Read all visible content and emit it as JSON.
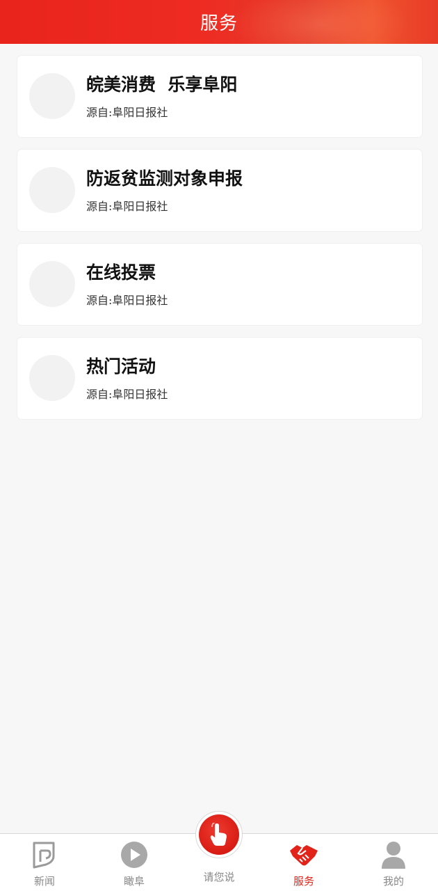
{
  "header": {
    "title": "服务"
  },
  "services": [
    {
      "title": "皖美消费  乐享阜阳",
      "source": "源自:阜阳日报社"
    },
    {
      "title": "防返贫监测对象申报",
      "source": "源自:阜阳日报社"
    },
    {
      "title": "在线投票",
      "source": "源自:阜阳日报社"
    },
    {
      "title": "热门活动",
      "source": "源自:阜阳日报社"
    }
  ],
  "tabbar": {
    "tabs": [
      {
        "label": "新闻",
        "icon": "news-icon"
      },
      {
        "label": "瞰阜",
        "icon": "play-icon"
      },
      {
        "label": "请您说",
        "icon": "tap-hand-icon"
      },
      {
        "label": "服务",
        "icon": "handshake-icon",
        "active": true
      },
      {
        "label": "我的",
        "icon": "user-icon"
      }
    ]
  },
  "colors": {
    "accent": "#e2231a",
    "inactive": "#888888",
    "background": "#f7f7f7"
  }
}
